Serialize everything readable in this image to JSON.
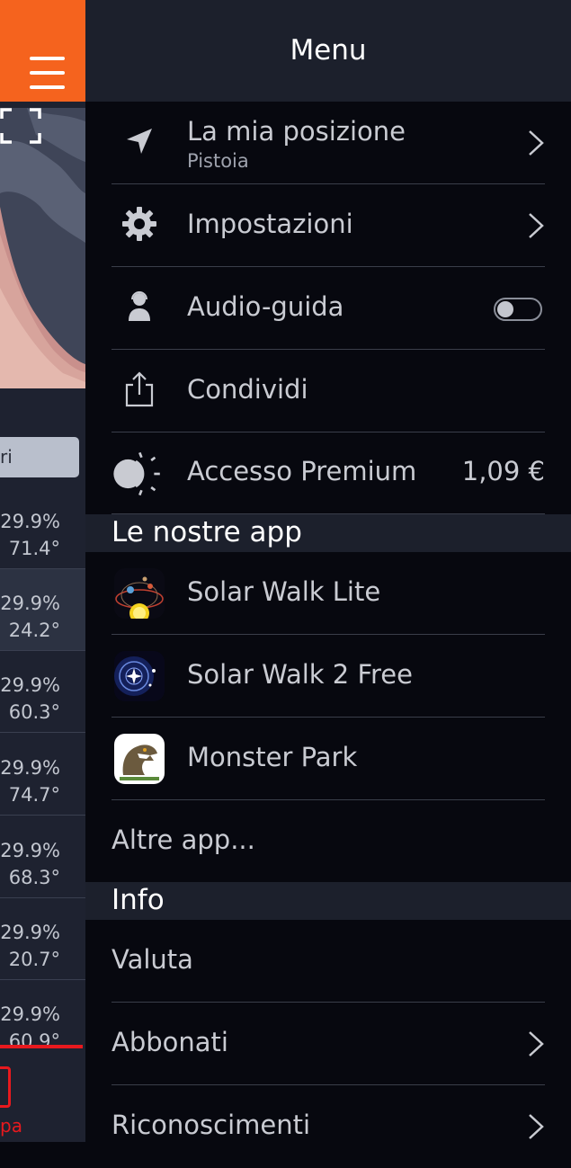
{
  "menu": {
    "title": "Menu",
    "items": [
      {
        "label": "La mia posizione",
        "sublabel": "Pistoia",
        "icon": "location-arrow-icon"
      },
      {
        "label": "Impostazioni",
        "icon": "gear-icon"
      },
      {
        "label": "Audio-guida",
        "icon": "audio-guide-icon",
        "toggle_on": false
      },
      {
        "label": "Condividi",
        "icon": "share-icon"
      },
      {
        "label": "Accesso Premium",
        "icon": "premium-sun-moon-icon",
        "price": "1,09 €"
      }
    ],
    "apps_section": {
      "title": "Le nostre app",
      "apps": [
        {
          "label": "Solar Walk Lite",
          "icon": "solar-walk-lite-app-icon"
        },
        {
          "label": "Solar Walk 2 Free",
          "icon": "solar-walk-2-free-app-icon"
        },
        {
          "label": "Monster Park",
          "icon": "monster-park-app-icon"
        }
      ],
      "more": "Altre app..."
    },
    "info_section": {
      "title": "Info",
      "items": [
        {
          "label": "Valuta"
        },
        {
          "label": "Abbonati"
        },
        {
          "label": "Riconoscimenti"
        }
      ]
    }
  },
  "background": {
    "filter_chip": "ri",
    "rows": [
      {
        "v1": "29.9%",
        "v2": "71.4°"
      },
      {
        "v1": "29.9%",
        "v2": "24.2°"
      },
      {
        "v1": "29.9%",
        "v2": "60.3°"
      },
      {
        "v1": "29.9%",
        "v2": "74.7°"
      },
      {
        "v1": "29.9%",
        "v2": "68.3°"
      },
      {
        "v1": "29.9%",
        "v2": "20.7°"
      },
      {
        "v1": "29.9%",
        "v2": "60.9°"
      }
    ],
    "tab_label": "pa"
  },
  "colors": {
    "accent_orange": "#f5631e",
    "alert_red": "#e8191e",
    "drawer_bg": "#07080f",
    "header_bg": "#1c202c"
  }
}
